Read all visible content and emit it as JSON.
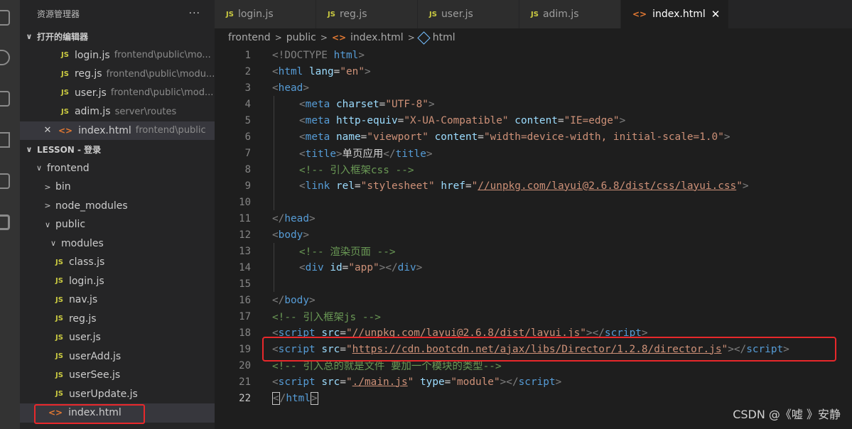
{
  "explorer": {
    "title": "资源管理器",
    "more_label": "···",
    "open_editors_label": "打开的编辑器",
    "open_editors": [
      {
        "name": "login.js",
        "path": "frontend\\public\\mo...",
        "type": "js"
      },
      {
        "name": "reg.js",
        "path": "frontend\\public\\modu...",
        "type": "js"
      },
      {
        "name": "user.js",
        "path": "frontend\\public\\mod...",
        "type": "js"
      },
      {
        "name": "adim.js",
        "path": "server\\routes",
        "type": "js"
      },
      {
        "name": "index.html",
        "path": "frontend\\public",
        "type": "html"
      }
    ],
    "workspace_label": "LESSON - 登录",
    "tree": {
      "frontend": "frontend",
      "bin": "bin",
      "node_modules": "node_modules",
      "public": "public",
      "modules": "modules",
      "files": [
        "class.js",
        "login.js",
        "nav.js",
        "reg.js",
        "user.js",
        "userAdd.js",
        "userSee.js",
        "userUpdate.js"
      ],
      "index_html": "index.html"
    }
  },
  "tabs": [
    {
      "label": "login.js",
      "type": "js"
    },
    {
      "label": "reg.js",
      "type": "js"
    },
    {
      "label": "user.js",
      "type": "js"
    },
    {
      "label": "adim.js",
      "type": "js"
    },
    {
      "label": "index.html",
      "type": "html",
      "active": true
    }
  ],
  "icons": {
    "js_badge": "JS",
    "html_badge": "<>",
    "close": "✕",
    "chevron_down": "∨",
    "chevron_right": ">"
  },
  "breadcrumb": [
    "frontend",
    "public",
    "index.html",
    "html"
  ],
  "editor": {
    "lines": [
      "1",
      "2",
      "3",
      "4",
      "5",
      "6",
      "7",
      "8",
      "9",
      "10",
      "11",
      "12",
      "13",
      "14",
      "15",
      "16",
      "17",
      "18",
      "19",
      "20",
      "21",
      "22"
    ],
    "current_line": "22"
  },
  "code": {
    "l1": {
      "a": "<!DOCTYPE",
      "b": "html",
      "c": ">"
    },
    "l2": {
      "tag": "html",
      "attr": "lang",
      "val": "\"en\""
    },
    "l3": {
      "tag": "head"
    },
    "l4": {
      "tag": "meta",
      "attr": "charset",
      "val": "\"UTF-8\""
    },
    "l5": {
      "tag": "meta",
      "attr1": "http-equiv",
      "val1": "\"X-UA-Compatible\"",
      "attr2": "content",
      "val2": "\"IE=edge\""
    },
    "l6": {
      "tag": "meta",
      "attr1": "name",
      "val1": "\"viewport\"",
      "attr2": "content",
      "val2": "\"width=device-width, initial-scale=1.0\""
    },
    "l7": {
      "tag": "title",
      "text": "单页应用",
      "close": "title"
    },
    "l8": {
      "comment": "<!-- 引入框架css -->"
    },
    "l9": {
      "tag": "link",
      "attr1": "rel",
      "val1": "\"stylesheet\"",
      "attr2": "href",
      "q": "\"",
      "url": "//unpkg.com/layui@2.6.8/dist/css/layui.css"
    },
    "l11": {
      "close": "head"
    },
    "l12": {
      "tag": "body"
    },
    "l13": {
      "comment": "<!-- 渲染页面 -->"
    },
    "l14": {
      "tag": "div",
      "attr": "id",
      "val": "\"app\"",
      "close": "div"
    },
    "l16": {
      "close": "body"
    },
    "l17": {
      "comment": "<!-- 引入框架js -->"
    },
    "l18": {
      "tag": "script",
      "attr": "src",
      "q": "\"",
      "url": "//unpkg.com/layui@2.6.8/dist/layui.js",
      "close": "script"
    },
    "l19": {
      "tag": "script",
      "attr": "src",
      "q": "\"",
      "url": "https://cdn.bootcdn.net/ajax/libs/Director/1.2.8/director.js",
      "close": "script"
    },
    "l20": {
      "comment": "<!-- 引入总的就是文件 要加一个模块的类型-->"
    },
    "l21": {
      "tag": "script",
      "attr1": "src",
      "q": "\"",
      "url": "./main.js",
      "attr2": "type",
      "val2": "\"module\"",
      "close": "script"
    },
    "l22": {
      "close": "html"
    }
  },
  "watermark": "CSDN @《嘘 》安静",
  "colors": {
    "highlight_box": "#e8282b",
    "js_badge": "#cbcb41",
    "html_badge": "#e37933"
  }
}
